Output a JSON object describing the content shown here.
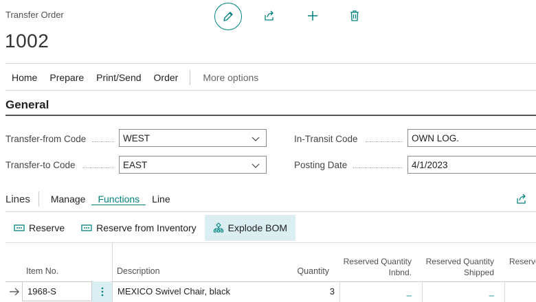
{
  "page": {
    "type_label": "Transfer Order",
    "number": "1002"
  },
  "toolbar": {
    "edit_icon": "pencil-icon",
    "share_icon": "share-icon",
    "new_icon": "plus-icon",
    "delete_icon": "trash-icon"
  },
  "menu": {
    "items": [
      "Home",
      "Prepare",
      "Print/Send",
      "Order"
    ],
    "more": "More options"
  },
  "general": {
    "title": "General",
    "transfer_from": {
      "label": "Transfer-from Code",
      "value": "WEST"
    },
    "transfer_to": {
      "label": "Transfer-to Code",
      "value": "EAST"
    },
    "in_transit": {
      "label": "In-Transit Code",
      "value": "OWN LOG."
    },
    "posting_date": {
      "label": "Posting Date",
      "value": "4/1/2023"
    }
  },
  "lines": {
    "title": "Lines",
    "tabs": [
      "Manage",
      "Functions",
      "Line"
    ],
    "active_tab": "Functions",
    "actions": [
      "Reserve",
      "Reserve from Inventory",
      "Explode BOM"
    ],
    "columns": {
      "item_no": "Item No.",
      "description": "Description",
      "quantity": "Quantity",
      "reserved_inbnd_1": "Reserved Quantity",
      "reserved_inbnd_2": "Inbnd.",
      "reserved_shipped_1": "Reserved Quantity",
      "reserved_shipped_2": "Shipped",
      "reserve_partial": "Reserve"
    },
    "rows": [
      {
        "item_no": "1968-S",
        "description": "MEXICO Swivel Chair, black",
        "quantity": "3",
        "reserved_inbnd": "_",
        "reserved_shipped": "_"
      }
    ]
  },
  "colors": {
    "accent": "#00827f",
    "highlight": "#dbeff2"
  }
}
